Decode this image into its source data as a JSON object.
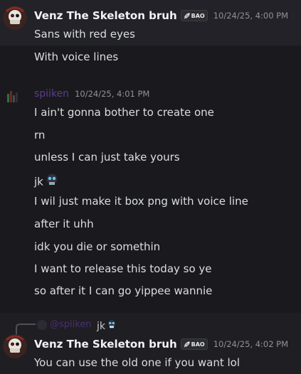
{
  "messages": [
    {
      "author": "Venz The Skeleton bruh",
      "badge": "BAO",
      "timestamp": "10/24/25, 4:00 PM",
      "lines": [
        "Sans with red eyes",
        "With voice lines"
      ]
    },
    {
      "author": "spiiken",
      "timestamp": "10/24/25, 4:01 PM",
      "lines": [
        "I ain't gonna bother to create one",
        "rn",
        "unless I can just take yours",
        "jk",
        "I wil just make it box png with voice line",
        "after it uhh",
        "idk you die or somethin",
        "I want to release this today so ye",
        "so after it I can go yippee wannie"
      ],
      "emoji": "skull-emoji"
    },
    {
      "reply_to_author": "@spiiken",
      "reply_text": "jk",
      "author": "Venz The Skeleton bruh",
      "badge": "BAO",
      "timestamp": "10/24/25, 4:02 PM",
      "lines": [
        "You can use the old one if you want lol"
      ]
    }
  ],
  "colors": {
    "background": "#1a1a1e",
    "highlight": "#222228",
    "text": "#dbdee1",
    "timestamp": "#8e9297",
    "spiiken_name": "#5b3b8a"
  }
}
